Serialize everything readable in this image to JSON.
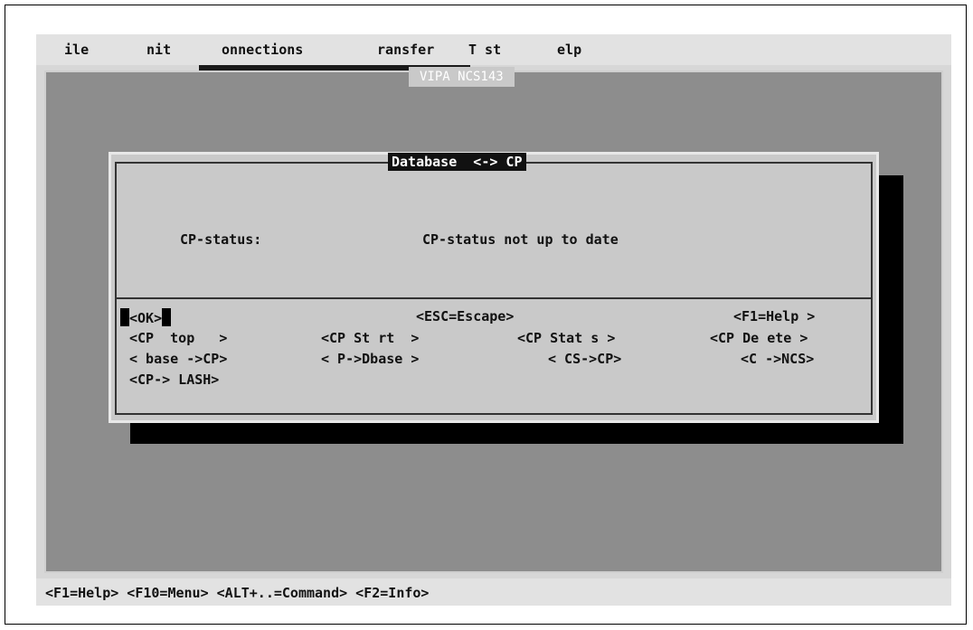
{
  "menubar": {
    "file": " ile",
    "init": " nit",
    "connections": " onnections",
    "transfer": " ransfer",
    "test": "T st",
    "help": " elp"
  },
  "app_title": "VIPA NCS143",
  "dialog": {
    "title": "Database  <-> CP",
    "status_label": "CP-status:",
    "status_value": "CP-status not up to date",
    "buttons": {
      "ok": "<OK>",
      "escape": "<ESC=Escape>",
      "help": "<F1=Help >",
      "cp_stop": "<CP  top   >",
      "cp_start": "<CP St rt  >",
      "cp_status": "<CP Stat s >",
      "cp_delete": "<CP De ete >",
      "dbase_to_cp": "< base ->CP>",
      "cp_to_dbase": "< P->Dbase >",
      "ncs_to_cp": "< CS->CP>",
      "cp_to_ncs": "<C ->NCS>",
      "cp_to_flash": "<CP-> LASH>"
    }
  },
  "statusbar": "<F1=Help> <F10=Menu> <ALT+..=Command> <F2=Info>",
  "colors": {
    "background": "#8d8d8d",
    "dialog": "#c9c9c9",
    "bars": "#e2e2e2",
    "shadow": "#000000"
  }
}
